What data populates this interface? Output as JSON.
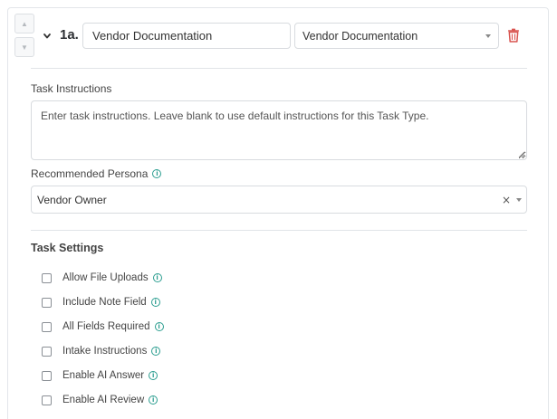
{
  "task": {
    "number": "1a.",
    "name_value": "Vendor Documentation",
    "type_selected": "Vendor Documentation"
  },
  "instructions": {
    "label": "Task Instructions",
    "placeholder": "Enter task instructions. Leave blank to use default instructions for this Task Type."
  },
  "persona": {
    "label": "Recommended Persona",
    "selected": "Vendor Owner",
    "clear": "×"
  },
  "settings": {
    "heading": "Task Settings",
    "items": [
      {
        "label": "Allow File Uploads",
        "checked": false
      },
      {
        "label": "Include Note Field",
        "checked": false
      },
      {
        "label": "All Fields Required",
        "checked": false
      },
      {
        "label": "Intake Instructions",
        "checked": false
      },
      {
        "label": "Enable AI Answer",
        "checked": false
      },
      {
        "label": "Enable AI Review",
        "checked": false
      }
    ]
  },
  "colors": {
    "accent_info": "#2a9d8f",
    "delete_red": "#d9534f"
  },
  "icons": {
    "move_up": "caret-up-icon",
    "move_down": "caret-down-icon",
    "collapse": "chevron-down-icon",
    "delete": "trash-icon",
    "info": "info-icon"
  }
}
